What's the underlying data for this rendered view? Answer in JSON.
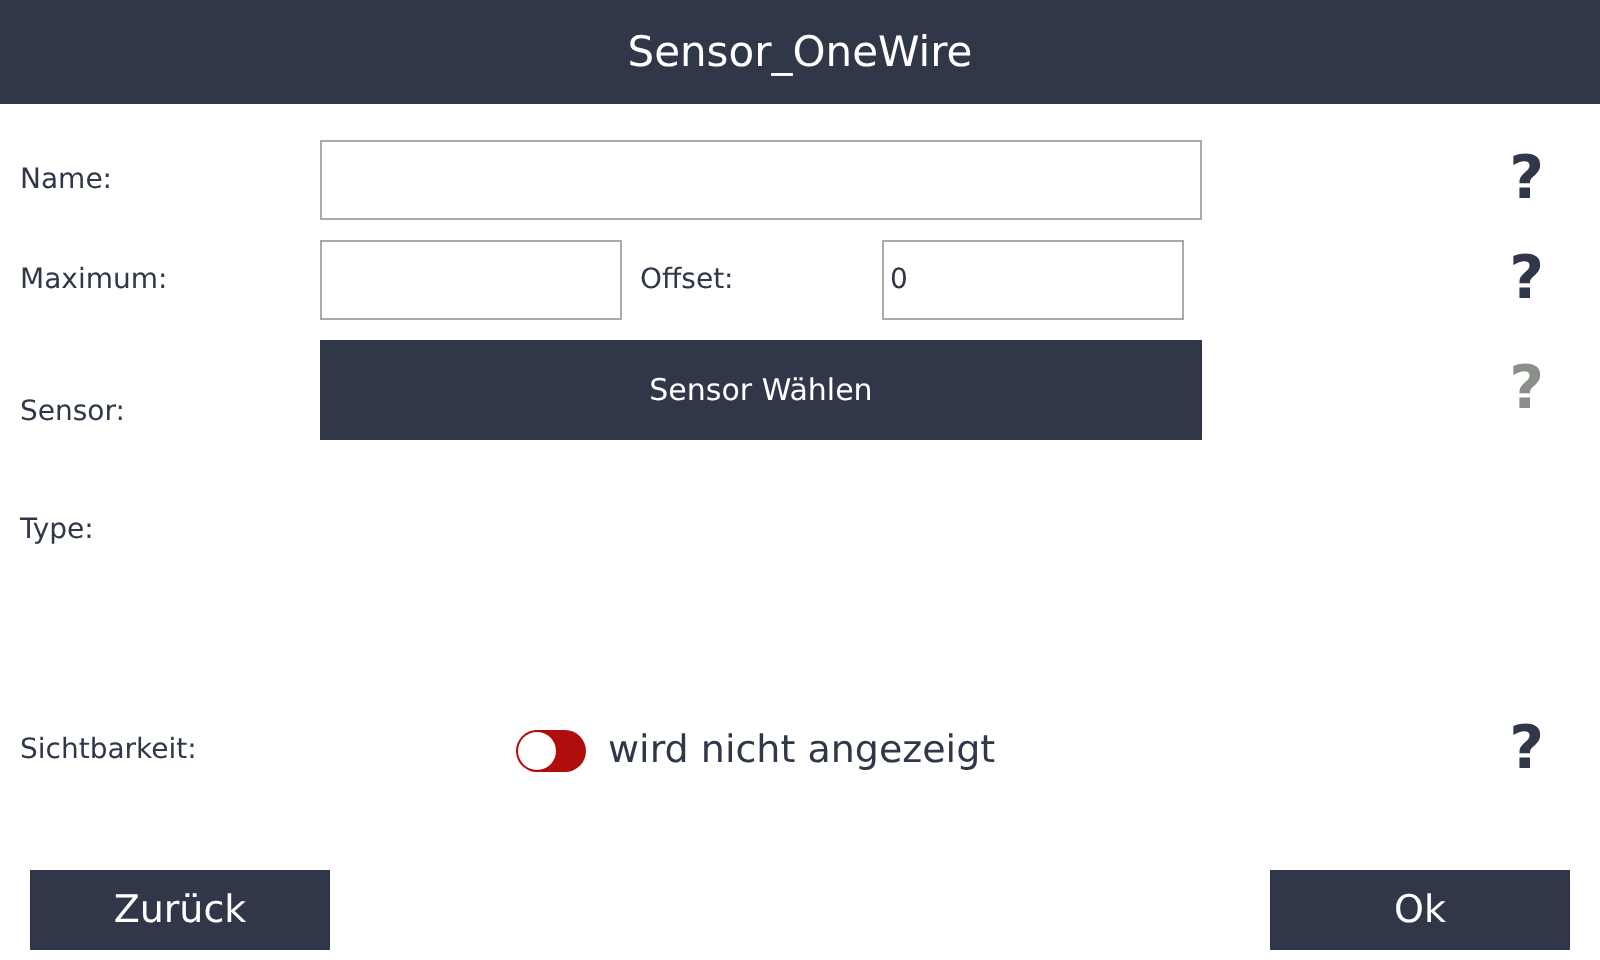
{
  "window": {
    "title": "Sensor_OneWire"
  },
  "rows": [
    {
      "kind": "text",
      "label": "Name:",
      "help": {
        "text": "?",
        "disabled": false
      }
    },
    {
      "kind": "pair",
      "label": "Maximum:",
      "second_label": "Offset:",
      "second_value": "0",
      "help": {
        "text": "?",
        "disabled": false
      }
    },
    {
      "kind": "button",
      "label": "Sensor:",
      "button": "Sensor Wählen",
      "help": {
        "text": "?",
        "disabled": true
      }
    },
    {
      "kind": "info",
      "label": "Type:"
    },
    {
      "kind": "toggle",
      "label": "Sichtbarkeit:",
      "on": false,
      "state_text": "wird nicht angezeigt",
      "help": {
        "text": "?",
        "disabled": false
      }
    }
  ],
  "buttons": [
    {
      "label": "Zurück"
    },
    {
      "label": "Ok"
    }
  ]
}
